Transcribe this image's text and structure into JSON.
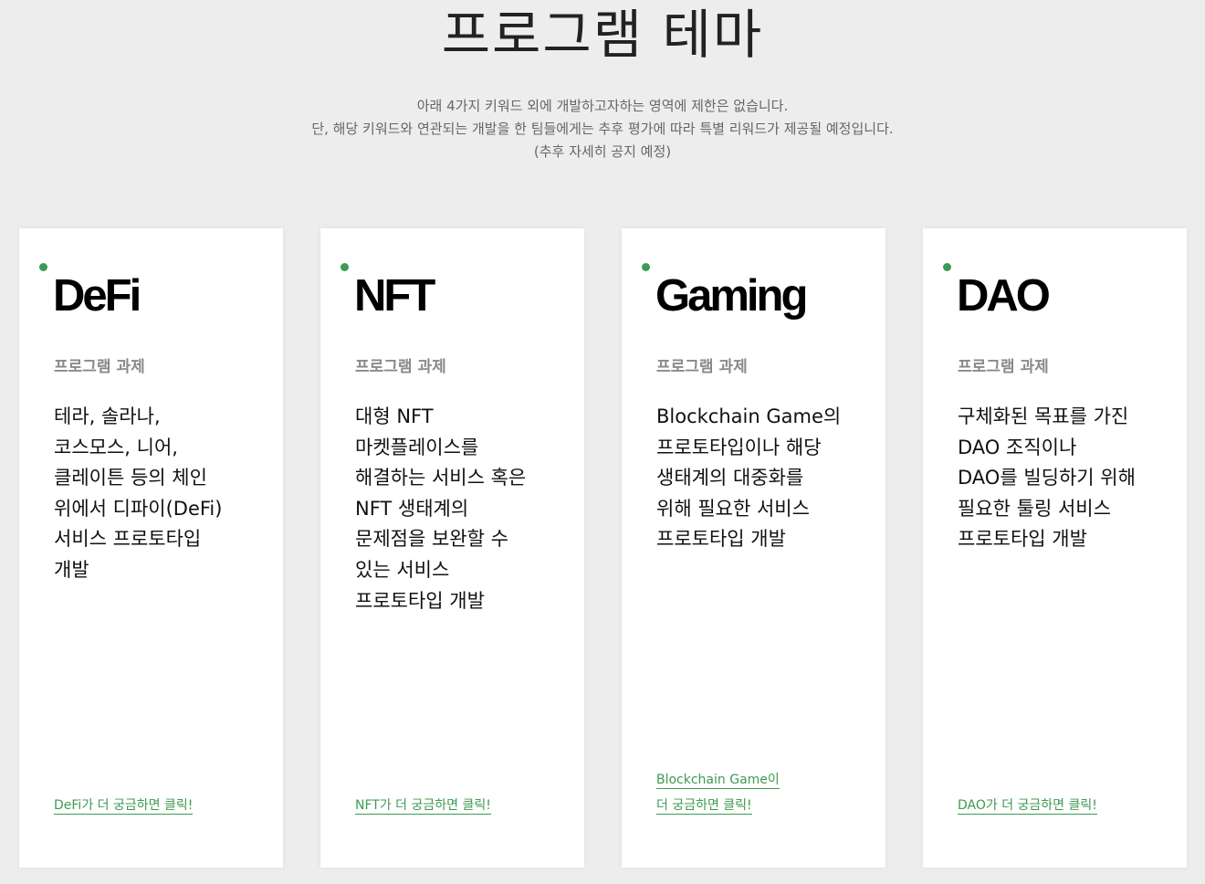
{
  "header": {
    "title": "프로그램 테마",
    "intro_lines": [
      "아래 4가지 키워드 외에 개발하고자하는 영역에 제한은 없습니다.",
      "단, 해당 키워드와 연관되는 개발을 한 팀들에게는 추후 평가에 따라 특별 리워드가 제공될 예정입니다.",
      "(추후 자세히 공지 예정)"
    ]
  },
  "theme": {
    "accent": "#3d9a52",
    "background": "#ededed",
    "card": "#ffffff"
  },
  "cards": [
    {
      "title": "DeFi",
      "subtitle": "프로그램 과제",
      "desc_lines": [
        "테라, 솔라나,",
        "코스모스, 니어,",
        "클레이튼 등의 체인",
        "위에서 디파이(DeFi)",
        "서비스 프로토타입",
        "개발"
      ],
      "link_lines": [
        "DeFi가 더 궁금하면 클릭!"
      ]
    },
    {
      "title": "NFT",
      "subtitle": "프로그램 과제",
      "desc_lines": [
        "대형 NFT",
        "마켓플레이스를",
        "해결하는 서비스 혹은",
        "NFT 생태계의",
        "문제점을 보완할 수",
        "있는 서비스",
        "프로토타입 개발"
      ],
      "link_lines": [
        "NFT가 더 궁금하면 클릭!"
      ]
    },
    {
      "title": "Gaming",
      "subtitle": "프로그램 과제",
      "desc_lines": [
        "Blockchain Game의",
        "프로토타입이나 해당",
        "생태계의 대중화를",
        "위해 필요한 서비스",
        "프로토타입 개발"
      ],
      "link_lines": [
        "Blockchain Game이",
        "더 궁금하면 클릭!"
      ]
    },
    {
      "title": "DAO",
      "subtitle": "프로그램 과제",
      "desc_lines": [
        "구체화된 목표를 가진",
        "DAO 조직이나",
        "DAO를 빌딩하기 위해",
        "필요한 툴링 서비스",
        "프로토타입 개발"
      ],
      "link_lines": [
        "DAO가 더 궁금하면 클릭!"
      ]
    }
  ]
}
